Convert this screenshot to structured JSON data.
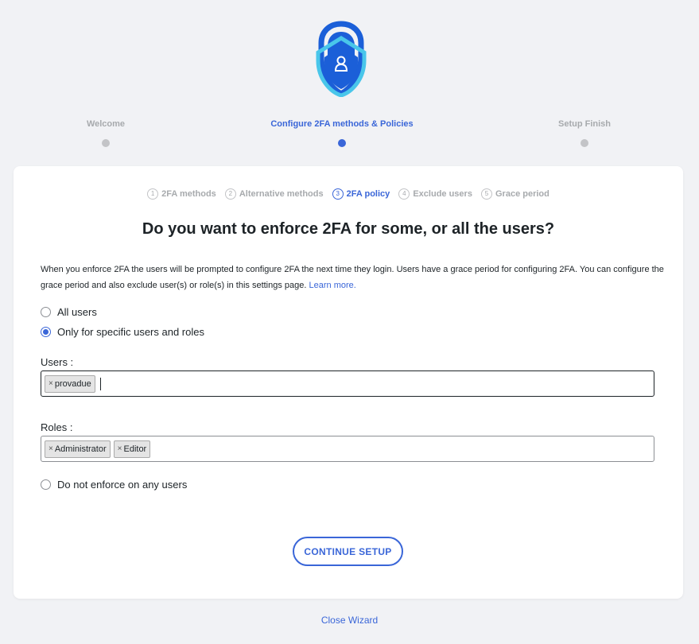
{
  "logo": {
    "icon": "shield-lock-icon",
    "colors": {
      "dark": "#1b5fd8",
      "light": "#49c6ea"
    }
  },
  "wizard_steps": [
    {
      "label": "Welcome",
      "active": false
    },
    {
      "label": "Configure 2FA methods & Policies",
      "active": true
    },
    {
      "label": "Setup Finish",
      "active": false
    }
  ],
  "sub_steps": [
    {
      "num": "1",
      "label": "2FA methods",
      "active": false
    },
    {
      "num": "2",
      "label": "Alternative methods",
      "active": false
    },
    {
      "num": "3",
      "label": "2FA policy",
      "active": true
    },
    {
      "num": "4",
      "label": "Exclude users",
      "active": false
    },
    {
      "num": "5",
      "label": "Grace period",
      "active": false
    }
  ],
  "heading": "Do you want to enforce 2FA for some, or all the users?",
  "description": {
    "text": "When you enforce 2FA the users will be prompted to configure 2FA the next time they login. Users have a grace period for configuring 2FA. You can configure the grace period and also exclude user(s) or role(s) in this settings page.",
    "link": "Learn more."
  },
  "options": {
    "all_users": {
      "label": "All users",
      "checked": false
    },
    "specific": {
      "label": "Only for specific users and roles",
      "checked": true
    },
    "none": {
      "label": "Do not enforce on any users",
      "checked": false
    }
  },
  "users": {
    "label": "Users :",
    "tags": [
      "provadue"
    ]
  },
  "roles": {
    "label": "Roles :",
    "tags": [
      "Administrator",
      "Editor"
    ]
  },
  "continue_label": "CONTINUE SETUP",
  "close_label": "Close Wizard",
  "accent_color": "#3a66d8"
}
